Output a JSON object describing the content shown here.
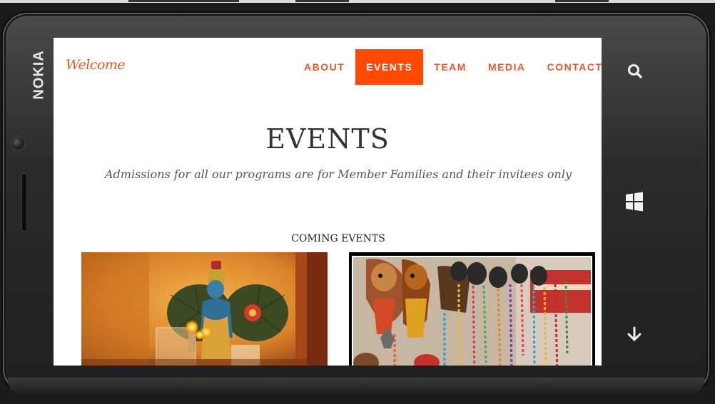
{
  "device": {
    "brand": "NOKIA",
    "buttons": {
      "search_icon": "search-icon",
      "start_icon": "windows-icon",
      "down_icon": "arrow-down-icon"
    }
  },
  "site": {
    "brand": "Welcome",
    "nav": [
      {
        "label": "ABOUT",
        "active": false
      },
      {
        "label": "EVENTS",
        "active": true
      },
      {
        "label": "TEAM",
        "active": false
      },
      {
        "label": "MEDIA",
        "active": false
      },
      {
        "label": "CONTACT",
        "active": false
      }
    ],
    "page_title": "EVENTS",
    "subtitle": "Admissions for all our programs are for Member Families and their invitees only",
    "section_title": "COMING EVENTS"
  },
  "colors": {
    "accent": "#ff4a00",
    "accent_text": "#e05a2b"
  }
}
